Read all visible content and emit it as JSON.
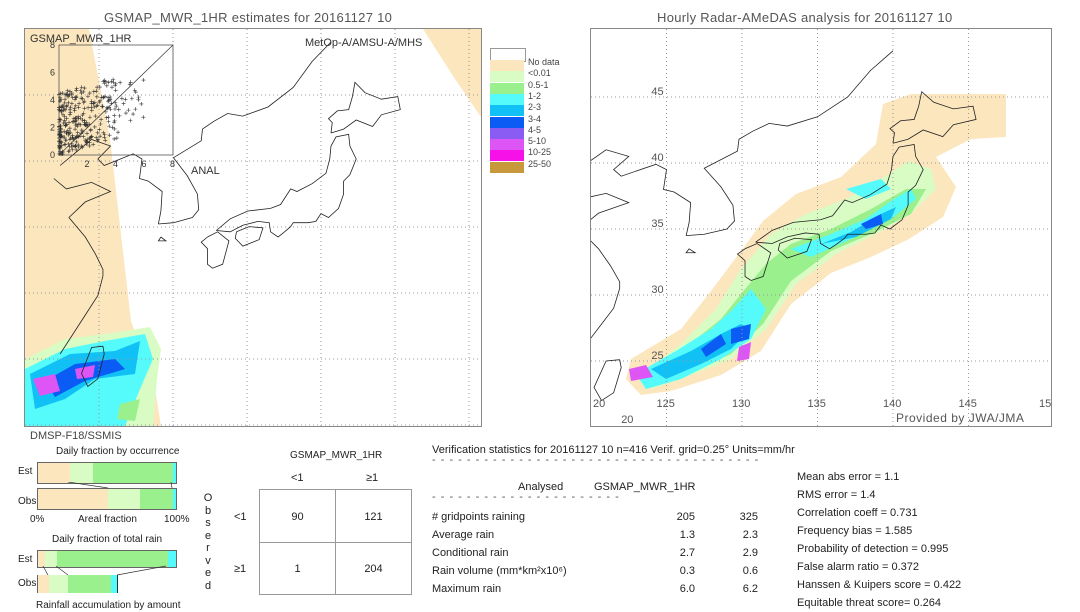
{
  "left_map": {
    "title": "GSMAP_MWR_1HR estimates for 20161127 10",
    "inset_label": "GSMAP_MWR_1HR",
    "inset_xlabel": "ANAL",
    "inset_ticks": [
      "0",
      "2",
      "4",
      "6",
      "8"
    ],
    "sensor_label": "MetOp-A/AMSU-A/MHS",
    "footer_sensor": "DMSP-F18/SSMIS"
  },
  "right_map": {
    "title": "Hourly Radar-AMeDAS analysis for 20161127 10",
    "lat_labels": [
      "45",
      "40",
      "35",
      "30",
      "25",
      "20"
    ],
    "lon_labels": [
      "20",
      "125",
      "130",
      "135",
      "140",
      "145",
      "15"
    ],
    "credit": "Provided by JWA/JMA"
  },
  "legend": {
    "items": [
      {
        "label": "No data",
        "color": "#fce6bd"
      },
      {
        "label": "<0.01",
        "color": "#d9fbc4"
      },
      {
        "label": "0.5-1",
        "color": "#99f08c"
      },
      {
        "label": "1-2",
        "color": "#55fbfb"
      },
      {
        "label": "2-3",
        "color": "#11c1f6"
      },
      {
        "label": "3-4",
        "color": "#0a5cf5"
      },
      {
        "label": "4-5",
        "color": "#8a5cf4"
      },
      {
        "label": "5-10",
        "color": "#dd55f5"
      },
      {
        "label": "10-25",
        "color": "#f511e8"
      },
      {
        "label": "25-50",
        "color": "#c8993a"
      }
    ]
  },
  "fraction_charts": {
    "occurrence_title": "Daily fraction by occurrence",
    "total_rain_title": "Daily fraction of total rain",
    "accumulation_title": "Rainfall accumulation by amount",
    "est_label": "Est",
    "obs_label": "Obs",
    "axis_left": "0%",
    "axis_center": "Areal fraction",
    "axis_right": "100%",
    "occurrence_est": [
      0.23,
      0.17,
      0.58,
      0.02
    ],
    "occurrence_obs": [
      0.51,
      0.23,
      0.24,
      0.02
    ],
    "total_est": [
      0.05,
      0.09,
      0.8,
      0.06
    ],
    "total_obs": [
      0.08,
      0.14,
      0.31,
      0.04
    ]
  },
  "contingency": {
    "header": "GSMAP_MWR_1HR",
    "col_labels": [
      "<1",
      "≥1"
    ],
    "row_labels": [
      "<1",
      "≥1"
    ],
    "observed_label": "Observed",
    "cells": [
      [
        "90",
        "121"
      ],
      [
        "1",
        "204"
      ]
    ]
  },
  "stats": {
    "heading": "Verification statistics for 20161127 10   n=416   Verif. grid=0.25°   Units=mm/hr",
    "col_analysed": "Analysed",
    "col_gsmap": "GSMAP_MWR_1HR",
    "rows": [
      {
        "label": "# gridpoints raining",
        "analysed": "205",
        "gsmap": "325"
      },
      {
        "label": "Average rain",
        "analysed": "1.3",
        "gsmap": "2.3"
      },
      {
        "label": "Conditional rain",
        "analysed": "2.7",
        "gsmap": "2.9"
      },
      {
        "label": "Rain volume (mm*km²x10⁶)",
        "analysed": "0.3",
        "gsmap": "0.6"
      },
      {
        "label": "Maximum rain",
        "analysed": "6.0",
        "gsmap": "6.2"
      }
    ],
    "scores": [
      "Mean abs error = 1.1",
      "RMS error = 1.4",
      "Correlation coeff = 0.731",
      "Frequency bias = 1.585",
      "Probability of detection = 0.995",
      "False alarm ratio = 0.372",
      "Hanssen & Kuipers score = 0.422",
      "Equitable threat score= 0.264"
    ]
  }
}
